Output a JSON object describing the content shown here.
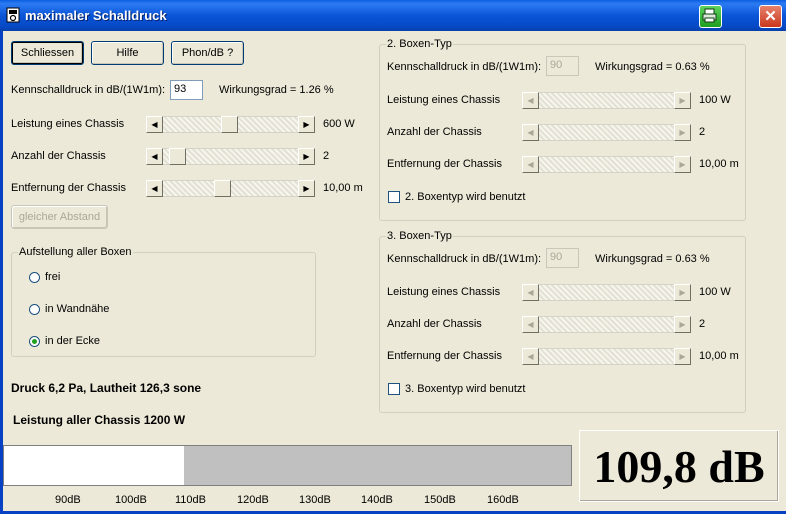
{
  "window": {
    "title": "maximaler Schalldruck",
    "close_glyph": "✕"
  },
  "buttons": {
    "schliessen": "Schliessen",
    "hilfe": "Hilfe",
    "phon": "Phon/dB ?",
    "gleicher_abstand": "gleicher Abstand"
  },
  "box1": {
    "kennschalldruck_label": "Kennschalldruck in dB/(1W1m):",
    "kennschalldruck_value": "93",
    "wirkungsgrad": "Wirkungsgrad = 1.26 %",
    "leistung_label": "Leistung eines Chassis",
    "leistung_value": "600 W",
    "leistung_pos": 0.5,
    "anzahl_label": "Anzahl der Chassis",
    "anzahl_value": "2",
    "anzahl_pos": 0.05,
    "entfernung_label": "Entfernung der Chassis",
    "entfernung_value": "10,00 m",
    "entfernung_pos": 0.44
  },
  "aufstellung": {
    "title": "Aufstellung aller Boxen",
    "options": [
      "frei",
      "in Wandnähe",
      "in der Ecke"
    ],
    "selected": "in der Ecke"
  },
  "results": {
    "druck": "Druck 6,2 Pa, Lautheit 126,3 sone",
    "leistung": "Leistung aller Chassis 1200 W"
  },
  "box2": {
    "title": "2. Boxen-Typ",
    "kennschalldruck_label": "Kennschalldruck in dB/(1W1m):",
    "kennschalldruck_value": "90",
    "wirkungsgrad": "Wirkungsgrad = 0.63 %",
    "leistung_label": "Leistung eines Chassis",
    "leistung_value": "100 W",
    "anzahl_label": "Anzahl der Chassis",
    "anzahl_value": "2",
    "entfernung_label": "Entfernung der Chassis",
    "entfernung_value": "10,00 m",
    "checkbox_label": "2. Boxentyp wird benutzt",
    "checked": false
  },
  "box3": {
    "title": "3. Boxen-Typ",
    "kennschalldruck_label": "Kennschalldruck in dB/(1W1m):",
    "kennschalldruck_value": "90",
    "wirkungsgrad": "Wirkungsgrad = 0.63 %",
    "leistung_label": "Leistung eines Chassis",
    "leistung_value": "100 W",
    "anzahl_label": "Anzahl der Chassis",
    "anzahl_value": "2",
    "entfernung_label": "Entfernung der Chassis",
    "entfernung_value": "10,00 m",
    "checkbox_label": "3. Boxentyp wird benutzt",
    "checked": false
  },
  "meter": {
    "ticks": [
      "90dB",
      "100dB",
      "110dB",
      "120dB",
      "130dB",
      "140dB",
      "150dB",
      "160dB"
    ],
    "level_fraction": 0.318,
    "readout": "109,8 dB"
  },
  "colors": {
    "titlebar": "#0A55D8",
    "window_bg": "#ECE9D8",
    "meter_bg": "#C0C0C0",
    "meter_fill": "#FFFFFF"
  }
}
